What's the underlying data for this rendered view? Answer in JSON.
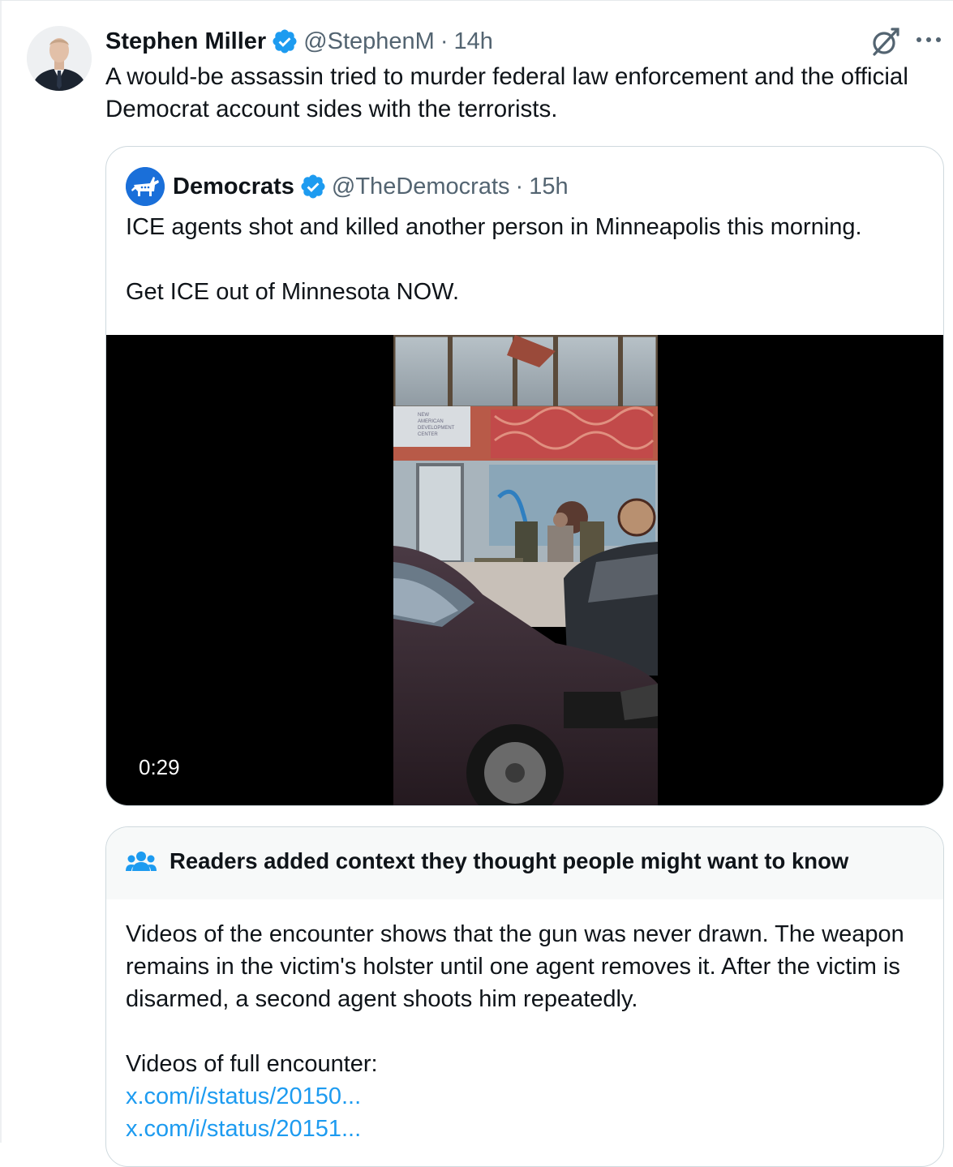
{
  "colors": {
    "accent": "#1d9bf0",
    "text": "#0f1419",
    "secondary": "#536471",
    "border": "#cfd9de",
    "verified_badge": "#1d9bf0",
    "democrats_avatar_bg": "#1a6fd9"
  },
  "post": {
    "author_name": "Stephen Miller",
    "author_handle": "@StephenM",
    "separator": "·",
    "time": "14h",
    "text": "A would-be assassin tried to murder federal law enforcement and the official Democrat account sides with the terrorists.",
    "icons": [
      "avatar",
      "verified-badge-icon",
      "grok-icon",
      "more-icon"
    ]
  },
  "quote": {
    "author_name": "Democrats",
    "author_handle": "@TheDemocrats",
    "separator": "·",
    "time": "15h",
    "text_line1": "ICE agents shot and killed another person in Minneapolis this morning.",
    "text_line2": "Get ICE out of Minnesota NOW.",
    "video": {
      "duration": "0:29",
      "sign_lines": [
        "NEW",
        "AMERICAN",
        "DEVELOPMENT",
        "CENTER"
      ]
    }
  },
  "community_note": {
    "title": "Readers added context they thought people might want to know",
    "body": "Videos of the encounter shows that the gun was never drawn. The weapon remains in the victim's holster until one agent removes it. After the victim is disarmed, a second agent shoots him repeatedly.",
    "links_label": "Videos of full encounter:",
    "links": [
      "x.com/i/status/20150...",
      "x.com/i/status/20151..."
    ]
  }
}
